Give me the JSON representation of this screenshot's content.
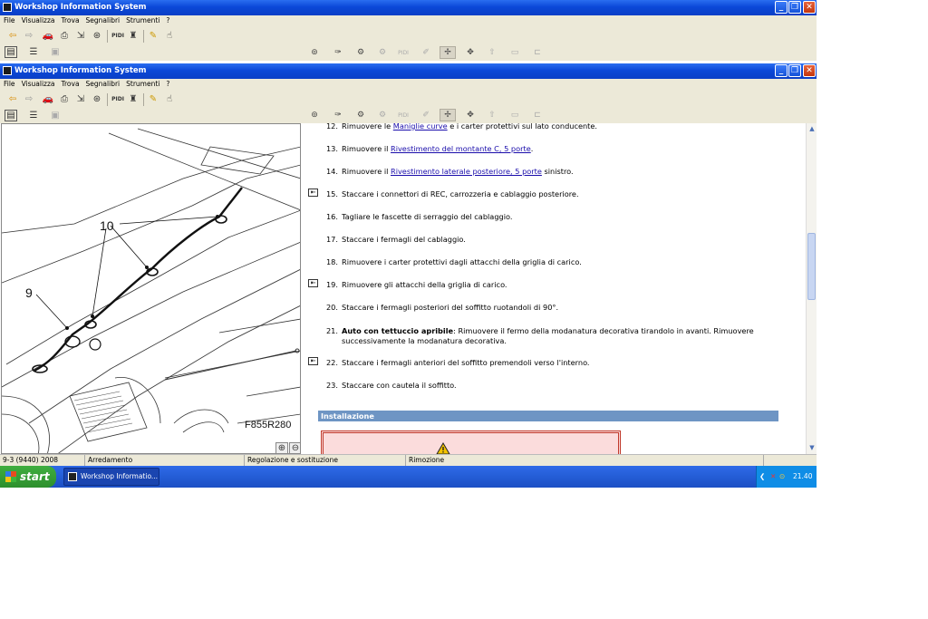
{
  "window": {
    "title": "Workshop Information System",
    "menu": [
      "File",
      "Visualizza",
      "Trova",
      "Segnalibri",
      "Strumenti",
      "?"
    ],
    "pidi_label": "PIDI",
    "min_label": "_",
    "max_label": "❐",
    "close_label": "✕"
  },
  "toolbar": {
    "icons": [
      "back-icon",
      "forward-icon",
      "vehicle-icon",
      "print-icon",
      "export-icon",
      "binoculars-icon",
      "pidi-icon",
      "trophy-icon",
      "highlighter-icon",
      "pointer-icon"
    ],
    "tabs_disabled_label": "PIDI"
  },
  "illustration": {
    "callout_9": "9",
    "callout_10": "10",
    "figure_code": "F855R280",
    "zoom_in": "⊕",
    "zoom_out": "⊖"
  },
  "procedure": {
    "steps": [
      {
        "n": "12.",
        "pre": "Rimuovere le ",
        "link": "Maniglie curve",
        "post": " e i carter protettivi sul lato conducente."
      },
      {
        "n": "13.",
        "pre": "Rimuovere il ",
        "link": "Rivestimento del montante C, 5 porte",
        "post": "."
      },
      {
        "n": "14.",
        "pre": "Rimuovere il ",
        "link": "Rivestimento laterale posteriore, 5 porte",
        "post": " sinistro."
      },
      {
        "n": "15.",
        "pre": "Staccare i connettori di REC, carrozzeria e cablaggio posteriore.",
        "link": "",
        "post": ""
      },
      {
        "n": "16.",
        "pre": "Tagliare le fascette di serraggio del cablaggio.",
        "link": "",
        "post": ""
      },
      {
        "n": "17.",
        "pre": "Staccare i fermagli del cablaggio.",
        "link": "",
        "post": ""
      },
      {
        "n": "18.",
        "pre": "Rimuovere i carter protettivi dagli attacchi della griglia di carico.",
        "link": "",
        "post": ""
      },
      {
        "n": "19.",
        "pre": "Rimuovere gli attacchi della griglia di carico.",
        "link": "",
        "post": ""
      },
      {
        "n": "20.",
        "pre": "Staccare i fermagli posteriori del soffitto ruotandoli di 90°.",
        "link": "",
        "post": ""
      },
      {
        "n": "22.",
        "pre": "Staccare i fermagli anteriori del soffitto premendoli verso l'interno.",
        "link": "",
        "post": ""
      },
      {
        "n": "23.",
        "pre": "Staccare con cautela il soffitto.",
        "link": "",
        "post": ""
      }
    ],
    "step21": {
      "n": "21.",
      "bold": "Auto con tettuccio apribile",
      "line1": ": Rimuovere il fermo della modanatura decorativa tirandolo in avanti. Rimuovere",
      "line2": "successivamente la modanatura decorativa."
    },
    "section_header": "Installazione",
    "warning_icon": "warning-icon"
  },
  "status": {
    "model": "9-3 (9440) 2008",
    "group": "Arredamento",
    "operation": "Regolazione e sostituzione",
    "action": "Rimozione"
  },
  "taskbar": {
    "start": "start",
    "task": "Workshop Informatio...",
    "clock": "21.40"
  }
}
